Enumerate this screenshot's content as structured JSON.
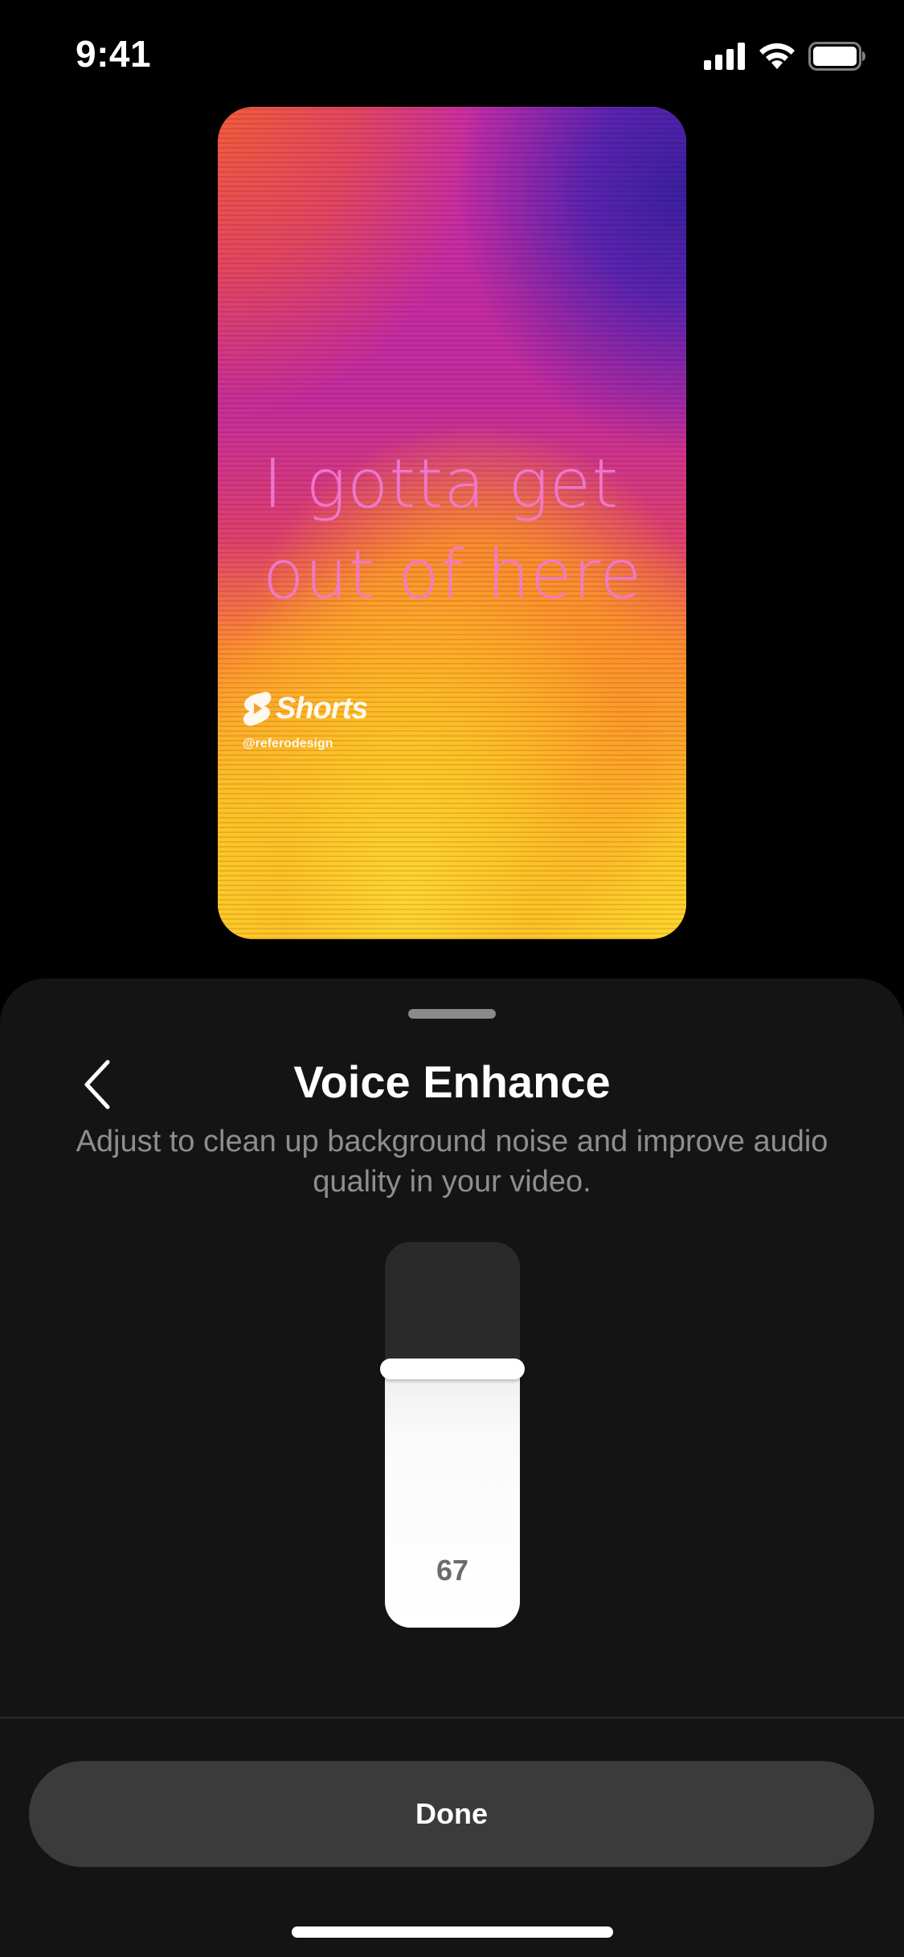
{
  "status_bar": {
    "time": "9:41",
    "icons": [
      "signal-icon",
      "wifi-icon",
      "battery-icon"
    ]
  },
  "preview": {
    "caption_line1": "I gotta get",
    "caption_line2": "out of here",
    "brand": "Shorts",
    "handle": "@referodesign",
    "colors": {
      "caption": "#f07ad6",
      "top": "#c72ca8",
      "bottom": "#ffd52c"
    }
  },
  "sheet": {
    "title": "Voice Enhance",
    "back_icon": "chevron-left-icon",
    "description": "Adjust to clean up background noise and improve audio quality in your video.",
    "slider": {
      "value": 67,
      "value_label": "67",
      "fill_fraction": 0.67
    },
    "done_label": "Done"
  }
}
